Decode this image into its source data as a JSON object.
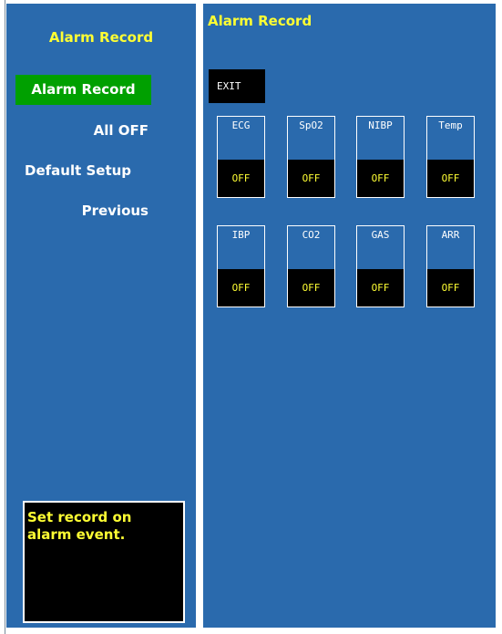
{
  "sidebar": {
    "title": "Alarm Record",
    "items": [
      {
        "label": "Alarm Record"
      },
      {
        "label": "All OFF"
      },
      {
        "label": "Default Setup"
      },
      {
        "label": "Previous"
      }
    ],
    "help_text": "Set record on alarm event."
  },
  "main": {
    "title": "Alarm Record",
    "exit_label": "EXIT",
    "tiles": [
      {
        "label": "ECG",
        "value": "OFF"
      },
      {
        "label": "SpO2",
        "value": "OFF"
      },
      {
        "label": "NIBP",
        "value": "OFF"
      },
      {
        "label": "Temp",
        "value": "OFF"
      },
      {
        "label": "IBP",
        "value": "OFF"
      },
      {
        "label": "CO2",
        "value": "OFF"
      },
      {
        "label": "GAS",
        "value": "OFF"
      },
      {
        "label": "ARR",
        "value": "OFF"
      }
    ]
  },
  "colors": {
    "panel": "#2a6aad",
    "title_yellow": "#ffff33",
    "selected_green": "#00a000",
    "value_yellow": "#ffff33"
  }
}
